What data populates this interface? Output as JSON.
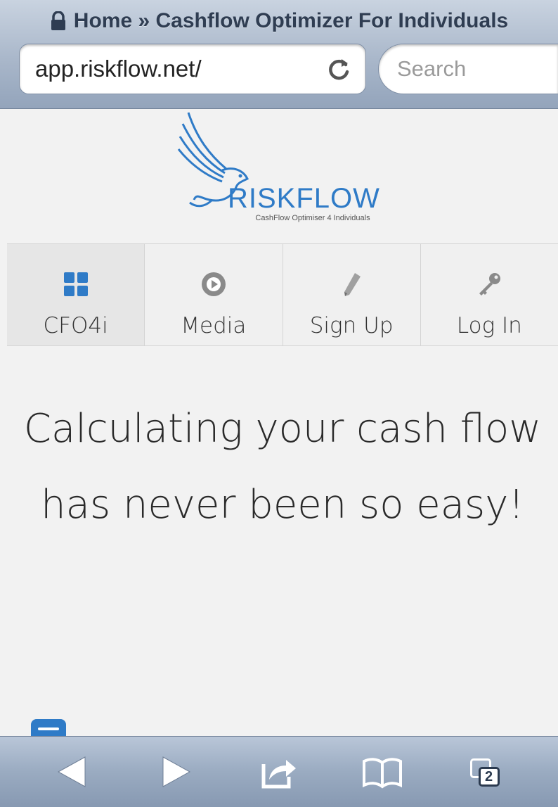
{
  "browser": {
    "page_title": "Home » Cashflow Optimizer For Individuals",
    "url": "app.riskflow.net/",
    "search_placeholder": "Search",
    "tabs_count": "2"
  },
  "site": {
    "brand_name": "RISKFLOW",
    "tagline": "CashFlow Optimiser 4 Individuals",
    "brand_color": "#2f7bc7"
  },
  "nav": {
    "items": [
      {
        "label": "CFO4i",
        "icon": "grid-icon"
      },
      {
        "label": "Media",
        "icon": "play-icon"
      },
      {
        "label": "Sign Up",
        "icon": "pencil-icon"
      },
      {
        "label": "Log In",
        "icon": "key-icon"
      }
    ]
  },
  "main": {
    "headline": "Calculating your cash flow has never been so easy!"
  }
}
